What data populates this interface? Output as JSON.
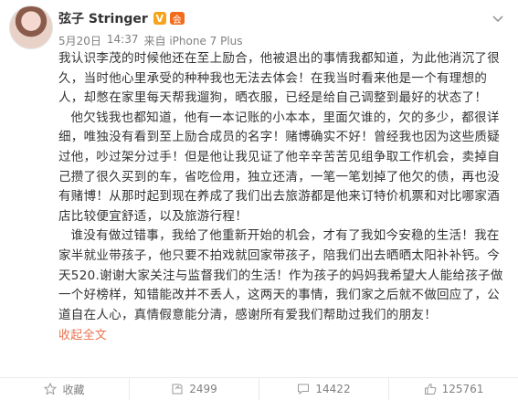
{
  "author": {
    "name": "弦子 Stringer",
    "vip_badge": "V",
    "level_badge": "会"
  },
  "meta": {
    "date": "5月20日",
    "time": "14:37",
    "source": "来自 iPhone 7 Plus"
  },
  "post": {
    "paragraphs": [
      "我认识李茂的时候他还在至上励合，他被退出的事情我都知道，为此他消沉了很久，当时他心里承受的种种我也无法去体会！在我当时看来他是一个有理想的人，却憋在家里每天帮我遛狗，晒衣服，已经是给自己调整到最好的状态了！",
      "他欠钱我也都知道，他有一本记账的小本本，里面欠谁的，欠的多少，都很详细，唯独没有看到至上励合成员的名字！赌博确实不好！曾经我也因为这些质疑过他，吵过架分过手！但是他让我见证了他辛辛苦苦见组争取工作机会，卖掉自己攒了很久买到的车，省吃俭用，独立还清，一笔一笔划掉了他欠的债，再也没有赌博！从那时起到现在养成了我们出去旅游都是他来订特价机票和对比哪家酒店比较便宜舒适，以及旅游行程！",
      "谁没有做过错事，我给了他重新开始的机会，才有了我如今安稳的生活！我在家半就业带孩子，他只要不拍戏就回家带孩子，陪我们出去晒晒太阳补补钙。今天520.谢谢大家关注与监督我们的生活！作为孩子的妈妈我希望大人能给孩子做一个好榜样，知错能改并不丢人，这两天的事情，我们家之后就不做回应了，公道自在人心，真情假意能分清，感谢所有爱我们帮助过我们的朋友！"
    ],
    "collapse_label": "收起全文"
  },
  "actions": {
    "favorite_label": "收藏",
    "repost_count": "2499",
    "comment_count": "14422",
    "like_count": "125761"
  },
  "colors": {
    "link": "#eb7350",
    "meta": "#808080",
    "text": "#333333"
  }
}
